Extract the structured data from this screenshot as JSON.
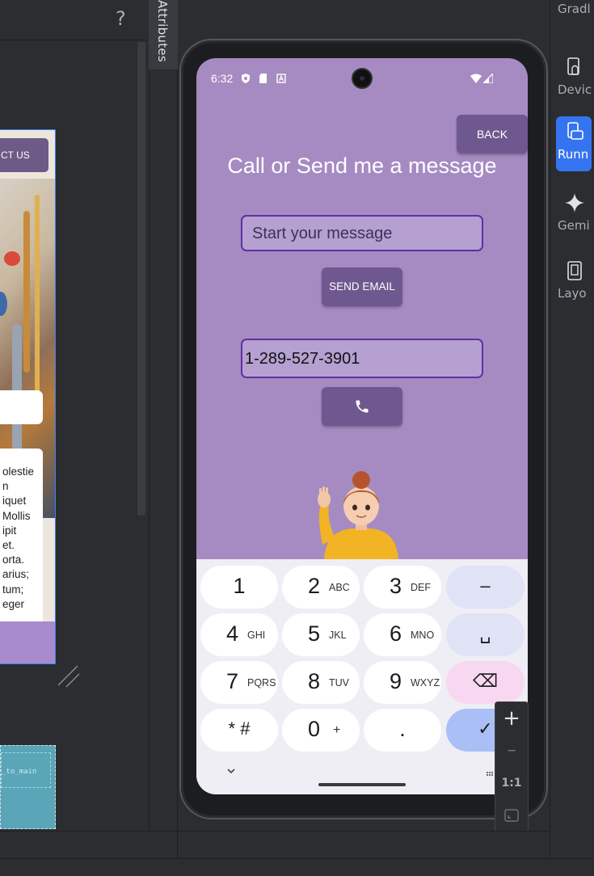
{
  "ide": {
    "help_glyph": "?",
    "attributes_tab": "Attributes",
    "right_tools": [
      {
        "label": "Gradle",
        "icon": "gradle-icon"
      },
      {
        "label": "Device Manager",
        "icon": "device-manager-icon"
      },
      {
        "label": "Running Devices",
        "icon": "running-devices-icon",
        "active": true
      },
      {
        "label": "Gemini",
        "icon": "gemini-icon"
      },
      {
        "label": "Layout Inspector",
        "icon": "layout-inspector-icon"
      }
    ],
    "right_tools_visible_labels": [
      "Gradl",
      "Devic",
      "Runn",
      "Gemi",
      "Layo"
    ]
  },
  "design_preview": {
    "contact_button": "CT US",
    "card_text": "olestie\nn\niquet\nMollis\nipit\net.\norta.\narius;\ntum;\neger\n\ns\narcu.",
    "strip_label": "_to_main"
  },
  "device": {
    "status_time": "6:32",
    "app": {
      "back_label": "BACK",
      "title": "Call or Send me a message",
      "message_placeholder": "Start your message",
      "send_label": "SEND EMAIL",
      "phone_value": "1-289-527-3901",
      "call_icon": "phone-icon"
    },
    "keyboard": {
      "rows": [
        [
          {
            "main": "1",
            "sub": ""
          },
          {
            "main": "2",
            "sub": "ABC"
          },
          {
            "main": "3",
            "sub": "DEF"
          },
          {
            "main": "–",
            "sub": "",
            "type": "special"
          }
        ],
        [
          {
            "main": "4",
            "sub": "GHI"
          },
          {
            "main": "5",
            "sub": "JKL"
          },
          {
            "main": "6",
            "sub": "MNO"
          },
          {
            "main": "␣",
            "sub": "",
            "type": "special"
          }
        ],
        [
          {
            "main": "7",
            "sub": "PQRS"
          },
          {
            "main": "8",
            "sub": "TUV"
          },
          {
            "main": "9",
            "sub": "WXYZ"
          },
          {
            "main": "⌫",
            "sub": "",
            "type": "del"
          }
        ],
        [
          {
            "main": "* #",
            "sub": ""
          },
          {
            "main": "0",
            "sub": "+"
          },
          {
            "main": ".",
            "sub": ""
          },
          {
            "main": "✓",
            "sub": "",
            "type": "enter"
          }
        ]
      ]
    }
  },
  "zoom_controls": {
    "zoom_in": "+",
    "zoom_out": "–",
    "actual_size": "1:1"
  },
  "colors": {
    "app_background": "#a68bc2",
    "button": "#6f5890",
    "input_border": "#5e2fa6",
    "active_tool": "#3574f0"
  }
}
